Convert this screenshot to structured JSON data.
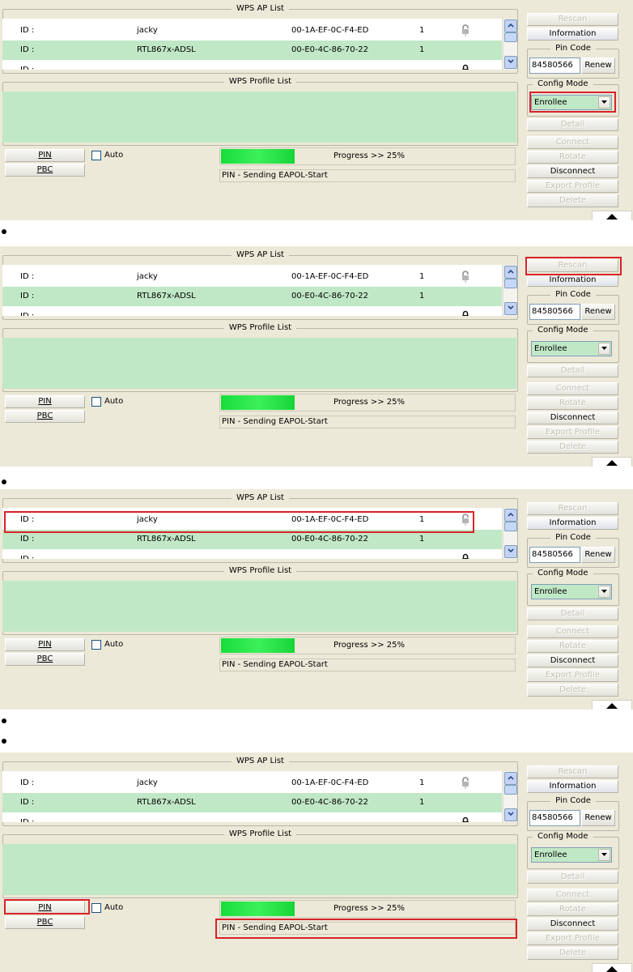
{
  "wps": {
    "ap_list_title": "WPS AP List",
    "profile_list_title": "WPS Profile List",
    "pin_code_title": "Pin Code",
    "config_mode_title": "Config Mode",
    "ap_rows": [
      {
        "id": "ID :",
        "name": "jacky",
        "mac": "00-1A-EF-0C-F4-ED",
        "channel": "1",
        "lock": "open-lock-icon"
      },
      {
        "id": "ID :",
        "name": "RTL867x-ADSL",
        "mac": "00-E0-4C-86-70-22",
        "channel": "1",
        "lock": ""
      },
      {
        "id": "ID :",
        "name": "",
        "mac": "",
        "channel": "",
        "lock": "lock-icon"
      }
    ],
    "buttons": {
      "rescan": "Rescan",
      "information": "Information",
      "renew": "Renew",
      "detail": "Detail",
      "connect": "Connect",
      "rotate": "Rotate",
      "disconnect": "Disconnect",
      "export_profile": "Export Profile",
      "delete": "Delete",
      "pin": "PIN",
      "pbc": "PBC"
    },
    "auto_label": "Auto",
    "pin_code_value": "84580566",
    "config_mode_value": "Enrollee",
    "progress_text": "Progress >> 25%",
    "progress_percent": 25,
    "status_text": "PIN - Sending EAPOL-Start"
  },
  "colors": {
    "panel_bg": "#ece9d8",
    "row_green": "#c1e8c6",
    "highlight": "#d8232a",
    "progress": "#22e040"
  }
}
